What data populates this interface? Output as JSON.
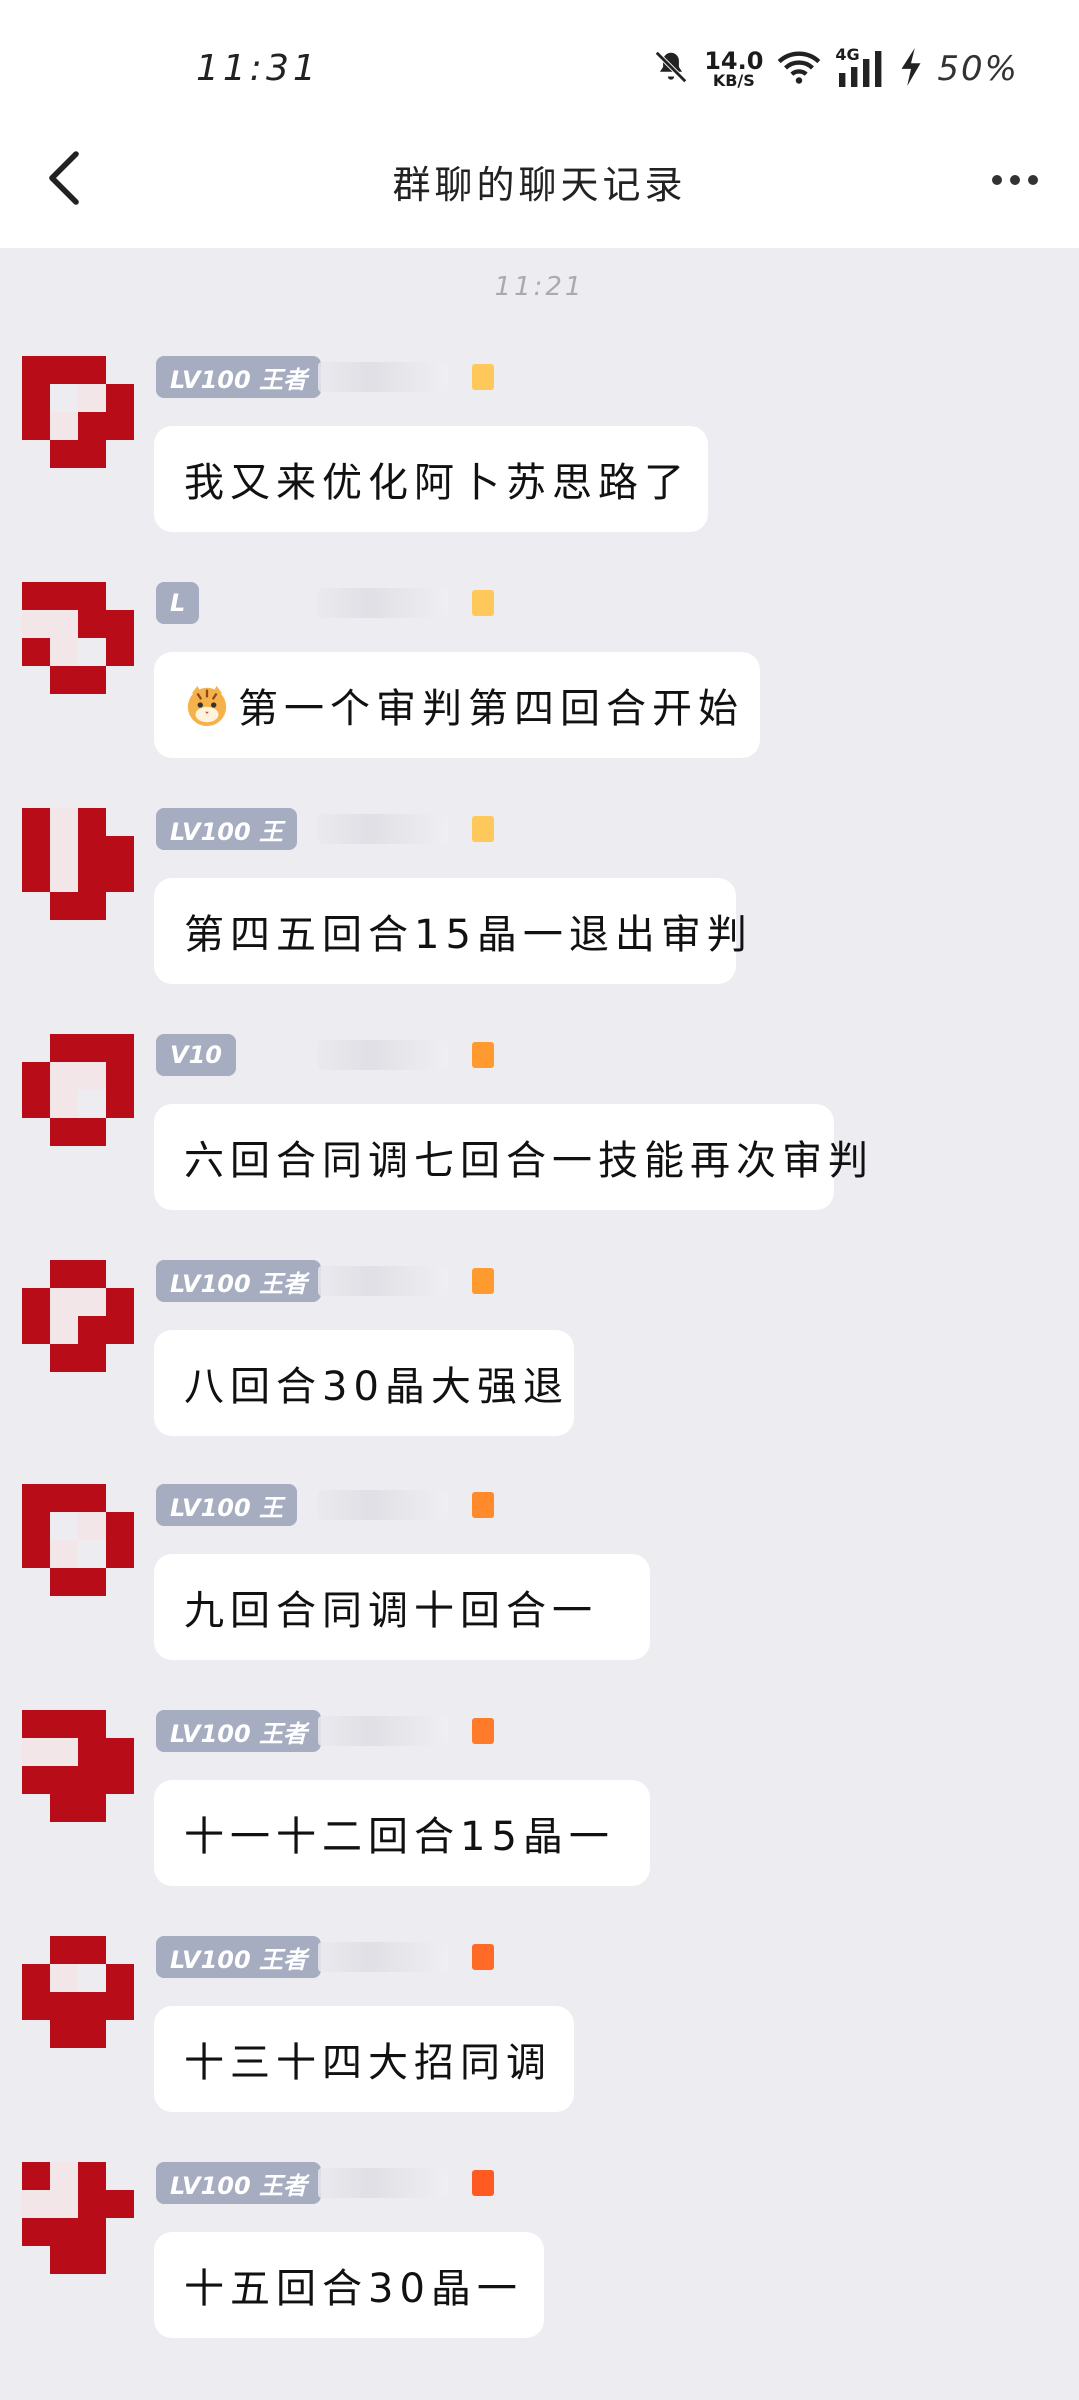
{
  "status_bar": {
    "time": "11:31",
    "net_speed_value": "14.0",
    "net_speed_unit": "KB/S",
    "signal_type": "4G",
    "battery": "50%",
    "icons": [
      "mute-bell-icon",
      "wifi-icon",
      "signal-icon",
      "charging-icon"
    ]
  },
  "nav": {
    "back_icon": "chevron-left-icon",
    "title": "群聊的聊天记录",
    "more_icon": "more-horizontal-icon"
  },
  "timestamp": "11:21",
  "colors": {
    "background": "#ececf1",
    "bubble": "#ffffff",
    "level_badge": "#a7adc1",
    "avatar_red": "#c0101a",
    "tag_orange": "#ff8a2b"
  },
  "messages": [
    {
      "badge": "LV100 王者",
      "text": "我又来优化阿卜苏思路了"
    },
    {
      "badge": "L",
      "text": "第一个审判第四回合开始",
      "emoji": "tiger-face-emoji"
    },
    {
      "badge": "LV100 王",
      "text": "第四五回合15晶一退出审判"
    },
    {
      "badge": "V10",
      "text": "六回合同调七回合一技能再次审判"
    },
    {
      "badge": "LV100 王者",
      "text": "八回合30晶大强退"
    },
    {
      "badge": "LV100 王",
      "text": "九回合同调十回合一"
    },
    {
      "badge": "LV100 王者",
      "text": "十一十二回合15晶一"
    },
    {
      "badge": "LV100 王者",
      "text": "十三十四大招同调"
    },
    {
      "badge": "LV100 王者",
      "text": "十五回合30晶一"
    }
  ]
}
